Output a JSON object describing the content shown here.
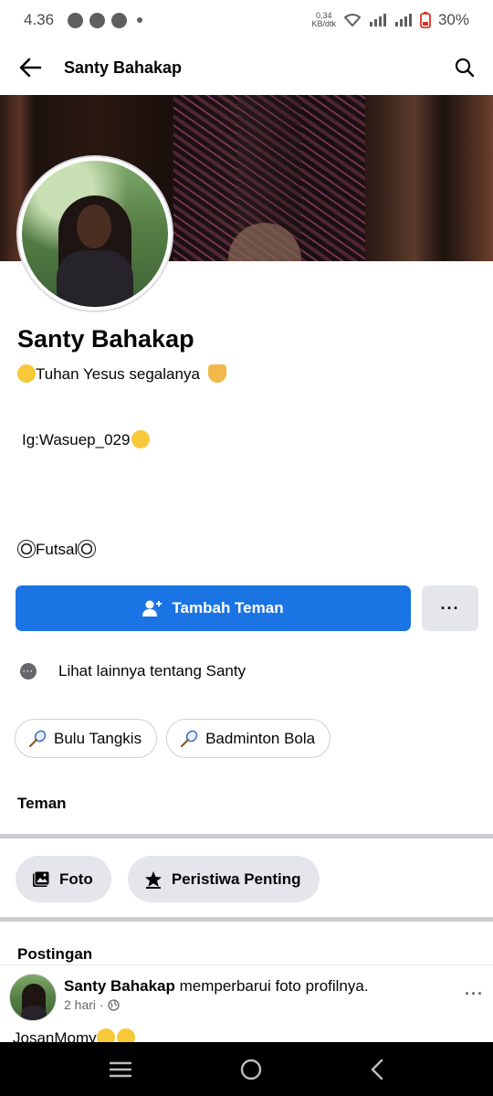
{
  "status_bar": {
    "time": "4.36",
    "net_speed_value": "0,34",
    "net_speed_unit": "KB/dtk",
    "battery_percent": "30%"
  },
  "header": {
    "title": "Santy Bahakap",
    "back_icon": "arrow-left-icon",
    "search_icon": "search-icon"
  },
  "profile": {
    "name": "Santy Bahakap",
    "bio_line_1": "Tuhan Yesus segalanya",
    "bio_line_2": "Ig:Wasuep_029",
    "bio_line_3": "Futsal"
  },
  "actions": {
    "add_friend_label": "Tambah Teman",
    "more_label": "···"
  },
  "see_more": {
    "label": "Lihat lainnya tentang Santy"
  },
  "interests": [
    {
      "label": "Bulu Tangkis",
      "icon": "badminton-racket-icon"
    },
    {
      "label": "Badminton Bola",
      "icon": "badminton-racket-icon"
    }
  ],
  "friends": {
    "title": "Teman"
  },
  "tabs": [
    {
      "label": "Foto",
      "icon": "photo-icon"
    },
    {
      "label": "Peristiwa Penting",
      "icon": "star-icon"
    }
  ],
  "posts": {
    "title": "Postingan",
    "items": [
      {
        "author": "Santy Bahakap",
        "action": "memperbarui foto profilnya.",
        "time": "2 hari",
        "separator": "·",
        "privacy_icon": "globe-icon",
        "caption": "JosanMomy"
      }
    ]
  },
  "colors": {
    "primary": "#1b74e4",
    "secondary_button": "#e4e6eb",
    "text": "#050505",
    "muted_text": "#65676b"
  }
}
